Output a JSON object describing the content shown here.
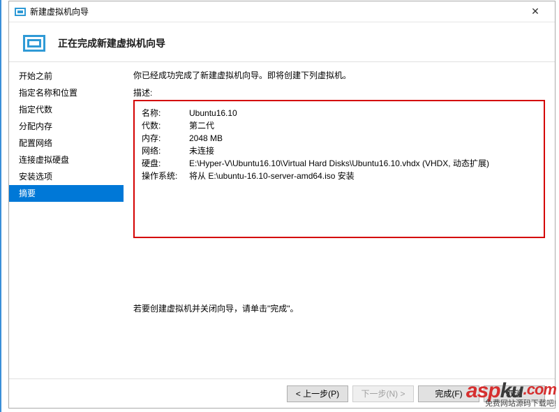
{
  "window": {
    "title": "新建虚拟机向导",
    "close_label": "✕"
  },
  "header": {
    "page_title": "正在完成新建虚拟机向导"
  },
  "sidebar": {
    "items": [
      {
        "label": "开始之前"
      },
      {
        "label": "指定名称和位置"
      },
      {
        "label": "指定代数"
      },
      {
        "label": "分配内存"
      },
      {
        "label": "配置网络"
      },
      {
        "label": "连接虚拟硬盘"
      },
      {
        "label": "安装选项"
      },
      {
        "label": "摘要"
      }
    ],
    "selected_index": 7
  },
  "main": {
    "intro": "你已经成功完成了新建虚拟机向导。即将创建下列虚拟机。",
    "description_label": "描述:",
    "rows": [
      {
        "key": "名称:",
        "value": "Ubuntu16.10"
      },
      {
        "key": "代数:",
        "value": "第二代"
      },
      {
        "key": "内存:",
        "value": "2048 MB"
      },
      {
        "key": "网络:",
        "value": "未连接"
      },
      {
        "key": "硬盘:",
        "value": "E:\\Hyper-V\\Ubuntu16.10\\Virtual Hard Disks\\Ubuntu16.10.vhdx (VHDX, 动态扩展)"
      },
      {
        "key": "操作系统:",
        "value": "将从 E:\\ubuntu-16.10-server-amd64.iso 安装"
      }
    ],
    "instruction": "若要创建虚拟机并关闭向导，请单击\"完成\"。"
  },
  "footer": {
    "prev": "< 上一步(P)",
    "next": "下一步(N) >",
    "finish": "完成(F)",
    "cancel": "取消"
  },
  "watermark": {
    "brand_a": "asp",
    "brand_b": "ku",
    "brand_c": ".com",
    "sub": "免费网站源码下载吧!"
  }
}
